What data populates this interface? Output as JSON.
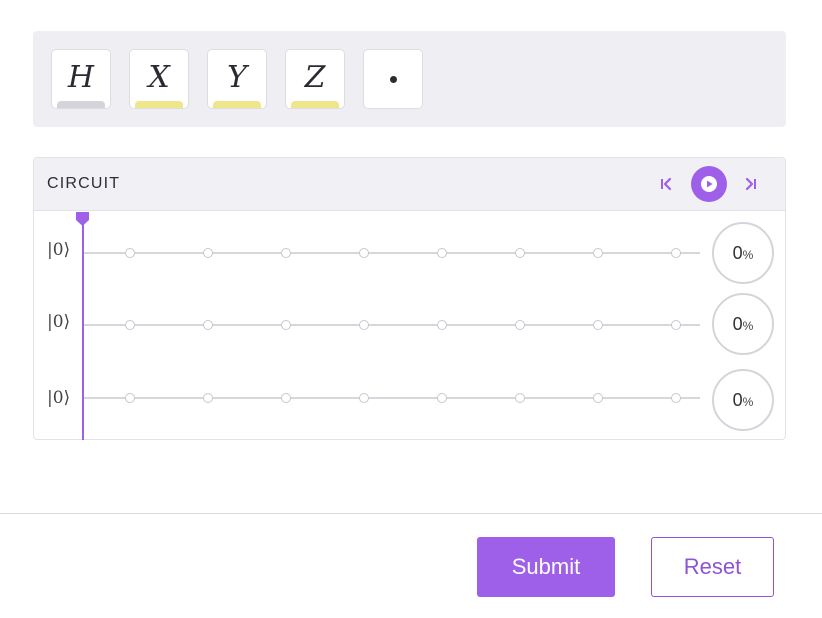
{
  "palette": {
    "gates": [
      {
        "label": "H",
        "bar_color": "#d4d4da"
      },
      {
        "label": "X",
        "bar_color": "#efe68a"
      },
      {
        "label": "Y",
        "bar_color": "#efe68a"
      },
      {
        "label": "Z",
        "bar_color": "#efe68a"
      }
    ],
    "control_icon": "control-dot-icon"
  },
  "circuit": {
    "title": "CIRCUIT",
    "controls": {
      "prev_icon": "skip-to-start-icon",
      "play_icon": "play-icon",
      "next_icon": "skip-to-end-icon"
    },
    "qubits": [
      {
        "state": "|0⟩",
        "probability": "0",
        "unit": "%"
      },
      {
        "state": "|0⟩",
        "probability": "0",
        "unit": "%"
      },
      {
        "state": "|0⟩",
        "probability": "0",
        "unit": "%"
      }
    ],
    "steps_per_wire": 8
  },
  "colors": {
    "accent": "#9e5fe9",
    "palette_bg": "#efeff3"
  },
  "footer": {
    "submit_label": "Submit",
    "reset_label": "Reset"
  }
}
